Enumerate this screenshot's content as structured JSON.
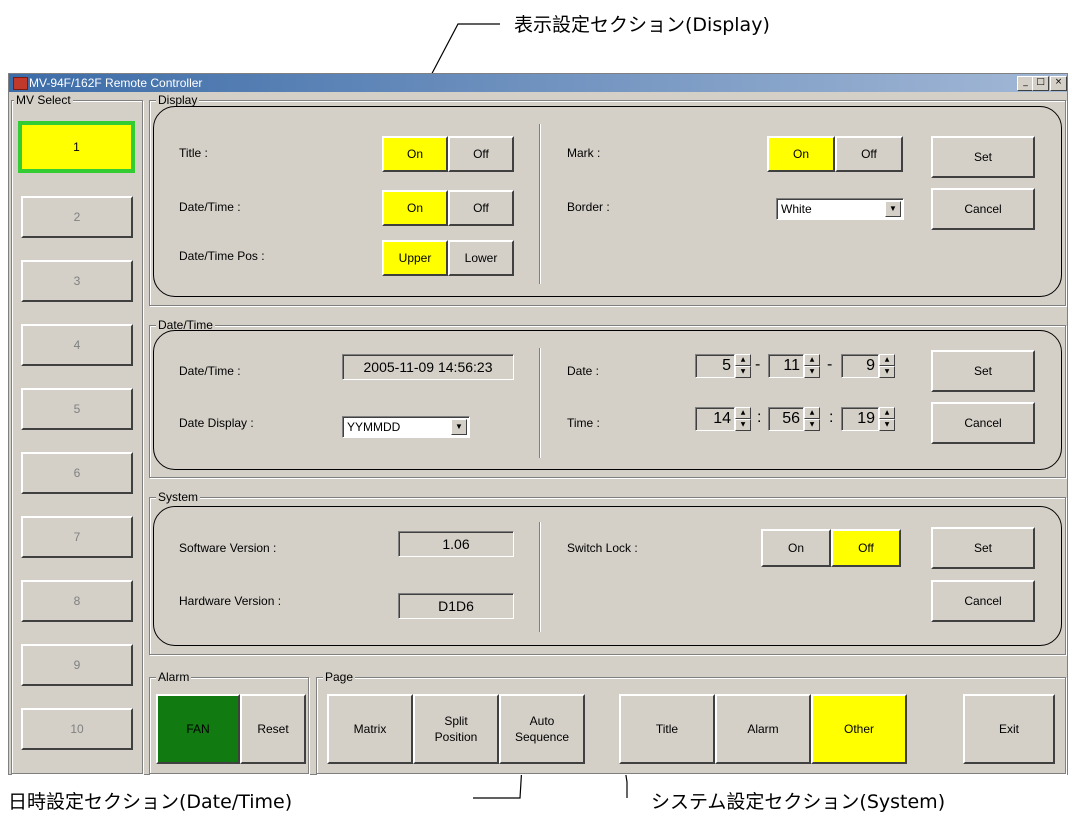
{
  "annotations": {
    "display_section": "表示設定セクション(Display)",
    "datetime_section": "日時設定セクション(Date/Time)",
    "system_section": "システム設定セクション(System)"
  },
  "window": {
    "title": "MV-94F/162F Remote Controller",
    "minimize": "_",
    "maximize": "□",
    "close": "×"
  },
  "mv_select": {
    "label": "MV Select",
    "items": [
      "1",
      "2",
      "3",
      "4",
      "5",
      "6",
      "7",
      "8",
      "9",
      "10"
    ],
    "selected": "1"
  },
  "display": {
    "label": "Display",
    "title_label": "Title :",
    "datetime_label": "Date/Time :",
    "datetime_pos_label": "Date/Time Pos :",
    "mark_label": "Mark :",
    "border_label": "Border :",
    "on": "On",
    "off": "Off",
    "upper": "Upper",
    "lower": "Lower",
    "border_value": "White",
    "set": "Set",
    "cancel": "Cancel"
  },
  "datetime": {
    "label": "Date/Time",
    "datetime_label": "Date/Time :",
    "datetime_value": "2005-11-09 14:56:23",
    "date_display_label": "Date Display :",
    "date_display_value": "YYMMDD",
    "date_label": "Date :",
    "time_label": "Time :",
    "date_year": "5",
    "date_month": "11",
    "date_day": "9",
    "date_sep": "-",
    "time_hour": "14",
    "time_min": "56",
    "time_sec": "19",
    "time_sep": ":",
    "set": "Set",
    "cancel": "Cancel"
  },
  "system": {
    "label": "System",
    "software_label": "Software Version :",
    "software_value": "1.06",
    "hardware_label": "Hardware Version :",
    "hardware_value": "D1D6",
    "switch_lock_label": "Switch Lock :",
    "on": "On",
    "off": "Off",
    "set": "Set",
    "cancel": "Cancel"
  },
  "alarm": {
    "label": "Alarm",
    "fan": "FAN",
    "reset": "Reset"
  },
  "page": {
    "label": "Page",
    "matrix": "Matrix",
    "split_position": "Split Position",
    "auto_sequence": "Auto Sequence",
    "title": "Title",
    "alarm": "Alarm",
    "other": "Other"
  },
  "exit": "Exit",
  "colors": {
    "active": "#ffff00",
    "selected_border": "#33cc33",
    "fan": "#117a11",
    "window_bg": "#d4d0c8"
  }
}
